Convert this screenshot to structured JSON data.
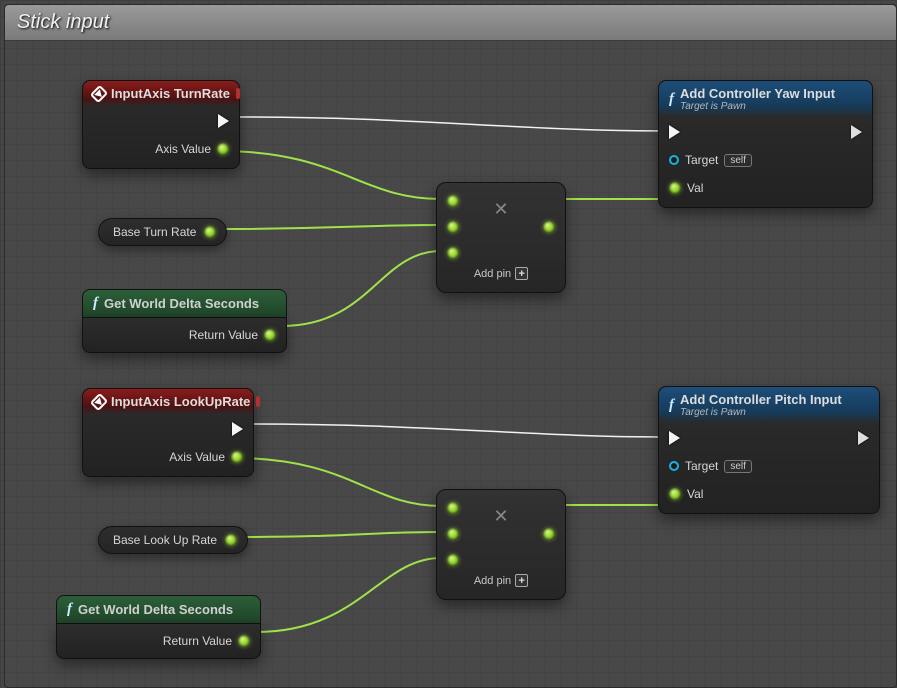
{
  "comment_title": "Stick input",
  "nodes": {
    "evt_turn": {
      "title": "InputAxis TurnRate",
      "axis_label": "Axis Value"
    },
    "evt_look": {
      "title": "InputAxis LookUpRate",
      "axis_label": "Axis Value"
    },
    "var_turn": {
      "label": "Base Turn Rate"
    },
    "var_look": {
      "label": "Base Look Up Rate"
    },
    "delta1": {
      "title": "Get World Delta Seconds",
      "out": "Return Value"
    },
    "delta2": {
      "title": "Get World Delta Seconds",
      "out": "Return Value"
    },
    "mult": {
      "add_pin": "Add pin"
    },
    "yaw": {
      "title": "Add Controller Yaw Input",
      "subtitle": "Target is Pawn",
      "target": "Target",
      "self": "self",
      "val": "Val"
    },
    "pitch": {
      "title": "Add Controller Pitch Input",
      "subtitle": "Target is Pawn",
      "target": "Target",
      "self": "self",
      "val": "Val"
    }
  },
  "icons": {
    "multiply": "✕"
  },
  "colors": {
    "exec_wire": "#f2f2f2",
    "data_wire": "#9fe24a"
  }
}
